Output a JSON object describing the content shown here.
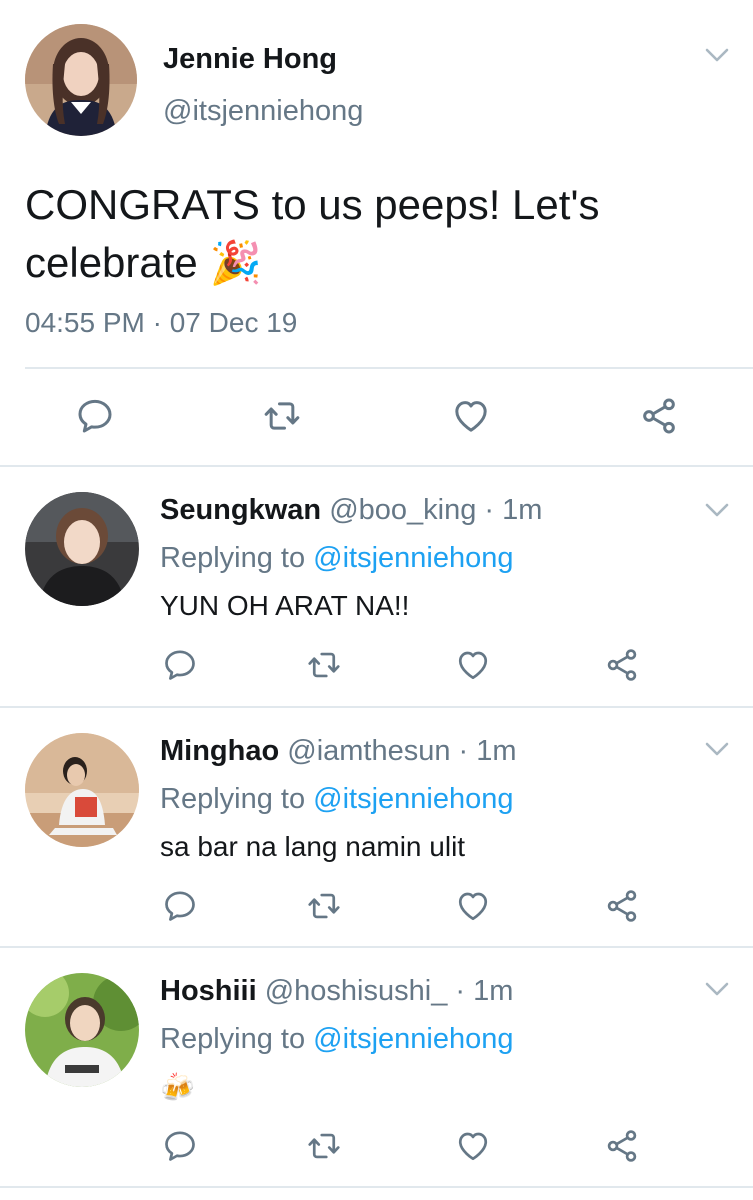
{
  "main_tweet": {
    "name": "Jennie Hong",
    "handle": "@itsjenniehong",
    "text": "CONGRATS to us peeps! Let's celebrate",
    "emoji": "🎉",
    "timestamp": "04:55 PM · 07 Dec 19",
    "actions": [
      "reply-icon",
      "retweet-icon",
      "like-icon",
      "share-icon"
    ]
  },
  "replies": [
    {
      "name": "Seungkwan",
      "handle_meta": "@boo_king · 1m",
      "replying_prefix": "Replying to",
      "replying_to": "@itsjenniehong",
      "text": "YUN OH ARAT NA!!"
    },
    {
      "name": "Minghao",
      "handle_meta": "@iamthesun · 1m",
      "replying_prefix": "Replying to",
      "replying_to": "@itsjenniehong",
      "text": "sa bar na lang namin ulit"
    },
    {
      "name": "Hoshiii",
      "handle_meta": "@hoshisushi_ · 1m",
      "replying_prefix": "Replying to",
      "replying_to": "@itsjenniehong",
      "text": "🍻"
    }
  ],
  "colors": {
    "text": "#14171a",
    "secondary": "#657786",
    "link": "#1da1f2",
    "divider": "#e1e8ed",
    "icon": "#657786"
  }
}
